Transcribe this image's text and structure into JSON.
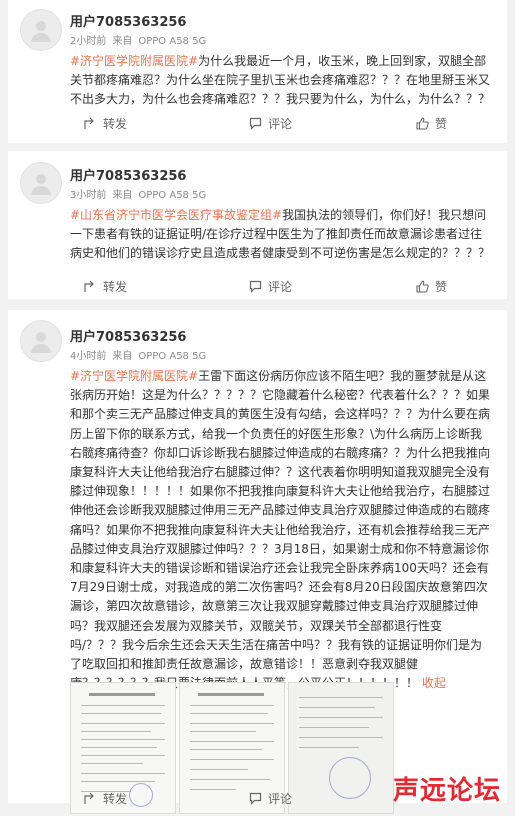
{
  "posts": [
    {
      "username": "用户7085363256",
      "time": "2小时前",
      "source_prefix": "来自",
      "device": "OPPO A58 5G",
      "tag": "#济宁医学院附属医院#",
      "text": "为什么我最近一个月，收玉米，晚上回到家，双腿全部关节都疼痛难忍？为什么坐在院子里扒玉米也会疼痛难忍？？？在地里掰玉米又不出多大力，为什么也会疼痛难忍？？？我只要为什么，为什么，为什么？？？",
      "actions": {
        "repost": "转发",
        "comment": "评论",
        "like": "赞"
      }
    },
    {
      "username": "用户7085363256",
      "time": "3小时前",
      "source_prefix": "来自",
      "device": "OPPO A58 5G",
      "tag": "#山东省济宁市医学会医疗事故鉴定组#",
      "text": "我国执法的领导们，你们好！我只想问一下患者有铁的证据证明/在诊疗过程中医生为了推卸责任而故意漏诊患者过往病史和他们的错误诊疗史且造成患者健康受到不可逆伤害是怎么规定的？？？？",
      "actions": {
        "repost": "转发",
        "comment": "评论",
        "like": "赞"
      }
    },
    {
      "username": "用户7085363256",
      "time": "4小时前",
      "source_prefix": "来自",
      "device": "OPPO A58 5G",
      "tag": "#济宁医学院附属医院#",
      "text": "王雷下面这份病历你应该不陌生吧？我的噩梦就是从这张病历开始！这是为什么？？？？？它隐藏着什么秘密？代表着什么？？？如果和那个卖三无产品膝过伸支具的黄医生没有勾结，会这样吗？？？为什么要在病历上留下你的联系方式，给我一个负责任的好医生形象？\\为什么病历上诊断我右髋疼痛待查？你却口诉诊断我右腿膝过伸造成的右髋疼痛？？为什么把我推向康复科许大夫让他给我治疗右腿膝过伸？？这代表着你明明知道我双腿完全没有膝过伸现象！！！！！如果你不把我推向康复科许大夫让他给我治疗，右腿膝过伸他还会诊断我双腿膝过伸用三无产品膝过伸支具治疗双腿膝过伸造成的右髋疼痛吗？如果你不把我推向康复科许大夫让他给我治疗，还有机会推荐给我三无产品膝过伸支具治疗双腿膝过伸吗？？？3月18日，如果谢士成和你不特意漏诊你和康复科许大夫的错误诊断和错误治疗还会让我完全卧床养病100天吗？还会有7月29日谢士成，对我造成的第二次伤害吗？还会有8月20日段国庆故意第四次漏诊，第四次故意错诊，故意第三次让我双腿穿戴膝过伸支具治疗双腿膝过伸吗？我双腿还会发展为双膝关节，双髋关节，双踝关节全部都退行性变吗/？？？我今后余生还会天天生活在痛苦中吗？？我有铁的证据证明你们是为了吃取回扣和推卸责任故意漏诊，故意错诊！！恶意剥夺我双腿健康？？？？？？我只要法律面前人人平等，公平公正！！！！！！",
      "more": "收起",
      "actions": {
        "repost": "转发",
        "comment": "评论",
        "like": "赞"
      }
    }
  ],
  "watermark": "声远论坛",
  "colors": {
    "accent": "#eb7350",
    "watermark": "#e12b32"
  }
}
